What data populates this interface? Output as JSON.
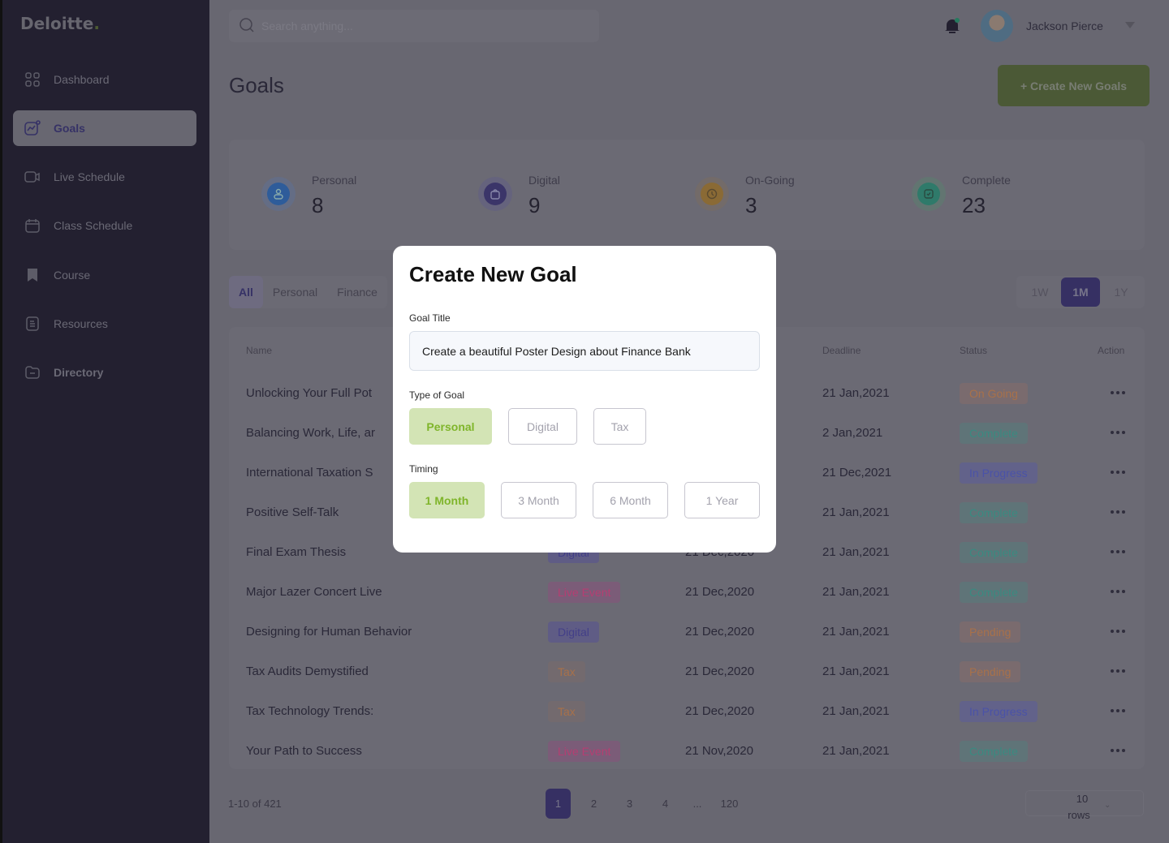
{
  "brand": {
    "name": "Deloitte",
    "dot": "."
  },
  "sidebar": {
    "items": [
      {
        "label": "Dashboard",
        "icon": "grid-icon"
      },
      {
        "label": "Goals",
        "icon": "goals-chart-icon",
        "active": true
      },
      {
        "label": "Live Schedule",
        "icon": "video-icon"
      },
      {
        "label": "Class Schedule",
        "icon": "calendar-icon"
      },
      {
        "label": "Course",
        "icon": "bookmark-icon"
      },
      {
        "label": "Resources",
        "icon": "document-icon"
      },
      {
        "label": "Directory",
        "icon": "folder-icon"
      }
    ]
  },
  "header": {
    "search_placeholder": "Search anything...",
    "user_name": "Jackson Pierce"
  },
  "page": {
    "title": "Goals",
    "create_button": "+ Create New Goals"
  },
  "stats": [
    {
      "label": "Personal",
      "value": "8",
      "color": "#2e5c9a"
    },
    {
      "label": "Digital",
      "value": "9",
      "color": "#3b3569"
    },
    {
      "label": "On-Going",
      "value": "3",
      "color": "#8a6a35"
    },
    {
      "label": "Complete",
      "value": "23",
      "color": "#2f7a6a"
    }
  ],
  "filters": {
    "tabs": [
      "All",
      "Personal",
      "Finance"
    ],
    "ranges": [
      "1W",
      "1M",
      "1Y"
    ]
  },
  "table": {
    "headers": {
      "name": "Name",
      "deadline": "Deadline",
      "status": "Status",
      "action": "Action"
    },
    "rows": [
      {
        "name": "Unlocking Your Full Pot",
        "type": "",
        "start": "",
        "deadline": "21 Jan,2021",
        "status": "On Going"
      },
      {
        "name": "Balancing Work, Life, ar",
        "type": "",
        "start": "",
        "deadline": "2 Jan,2021",
        "status": "Complete"
      },
      {
        "name": "International Taxation S",
        "type": "",
        "start": "",
        "deadline": "21 Dec,2021",
        "status": "In Progress"
      },
      {
        "name": "Positive Self-Talk",
        "type": "",
        "start": "",
        "deadline": "21 Jan,2021",
        "status": "Complete"
      },
      {
        "name": "Final Exam Thesis",
        "type": "Digital",
        "start": "21 Dec,2020",
        "deadline": "21 Jan,2021",
        "status": "Complete"
      },
      {
        "name": "Major Lazer Concert Live",
        "type": "Live Event",
        "start": "21 Dec,2020",
        "deadline": "21 Jan,2021",
        "status": "Complete"
      },
      {
        "name": "Designing for Human Behavior",
        "type": "Digital",
        "start": "21 Dec,2020",
        "deadline": "21 Jan,2021",
        "status": "Pending"
      },
      {
        "name": "Tax Audits Demystified",
        "type": "Tax",
        "start": "21 Dec,2020",
        "deadline": "21 Jan,2021",
        "status": "Pending"
      },
      {
        "name": "Tax Technology Trends:",
        "type": "Tax",
        "start": "21 Dec,2020",
        "deadline": "21 Jan,2021",
        "status": "In Progress"
      },
      {
        "name": "Your Path to Success",
        "type": "Live Event",
        "start": "21 Nov,2020",
        "deadline": "21 Jan,2021",
        "status": "Complete"
      }
    ]
  },
  "pagination": {
    "info": "1-10 of 421",
    "pages": [
      "1",
      "2",
      "3",
      "4",
      "...",
      "120"
    ],
    "current": "1",
    "rows_value": "10",
    "rows_label": "rows"
  },
  "modal": {
    "title": "Create New Goal",
    "goal_title_label": "Goal Title",
    "goal_title_value": "Create a beautiful Poster Design about Finance Bank",
    "type_label": "Type of Goal",
    "types": [
      "Personal",
      "Digital",
      "Tax"
    ],
    "selected_type": "Personal",
    "timing_label": "Timing",
    "timings": [
      "1 Month",
      "3 Month",
      "6 Month",
      "1 Year"
    ],
    "selected_timing": "1 Month"
  }
}
